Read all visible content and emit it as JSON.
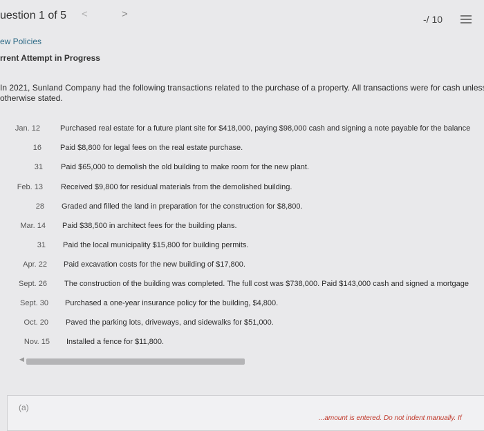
{
  "header": {
    "question_title": "uestion 1 of 5",
    "prev_glyph": "<",
    "next_glyph": ">",
    "score": "-/ 10",
    "menu_icon": "list-icon"
  },
  "links": {
    "policies": "ew Policies"
  },
  "status": {
    "attempt": "rrent Attempt in Progress"
  },
  "problem": {
    "intro_line1": "In 2021, Sunland Company had the following transactions related to the purchase of a property. All transactions were for cash unless",
    "intro_line2": "otherwise stated."
  },
  "transactions": [
    {
      "date": "Jan. 12",
      "desc": "Purchased real estate for a future plant site for $418,000, paying $98,000 cash and signing a note payable for the balance"
    },
    {
      "date": "16",
      "desc": "Paid $8,800 for legal fees on the real estate purchase."
    },
    {
      "date": "31",
      "desc": "Paid $65,000 to demolish the old building to make room for the new plant."
    },
    {
      "date": "Feb. 13",
      "desc": "Received $9,800 for residual materials from the demolished building."
    },
    {
      "date": "28",
      "desc": "Graded and filled the land in preparation for the construction for $8,800."
    },
    {
      "date": "Mar. 14",
      "desc": "Paid $38,500 in architect fees for the building plans."
    },
    {
      "date": "31",
      "desc": "Paid the local municipality $15,800 for building permits."
    },
    {
      "date": "Apr. 22",
      "desc": "Paid excavation costs for the new building of $17,800."
    },
    {
      "date": "Sept. 26",
      "desc": "The construction of the building was completed. The full cost was $738,000. Paid $143,000 cash and signed a mortgage"
    },
    {
      "date": "Sept. 30",
      "desc": "Purchased a one-year insurance policy for the building, $4,800."
    },
    {
      "date": "Oct. 20",
      "desc": "Paved the parking lots, driveways, and sidewalks for $51,000."
    },
    {
      "date": "Nov. 15",
      "desc": "Installed a fence for $11,800."
    }
  ],
  "part": {
    "label": "(a)",
    "note": "...amount is entered. Do not indent manually. If"
  }
}
